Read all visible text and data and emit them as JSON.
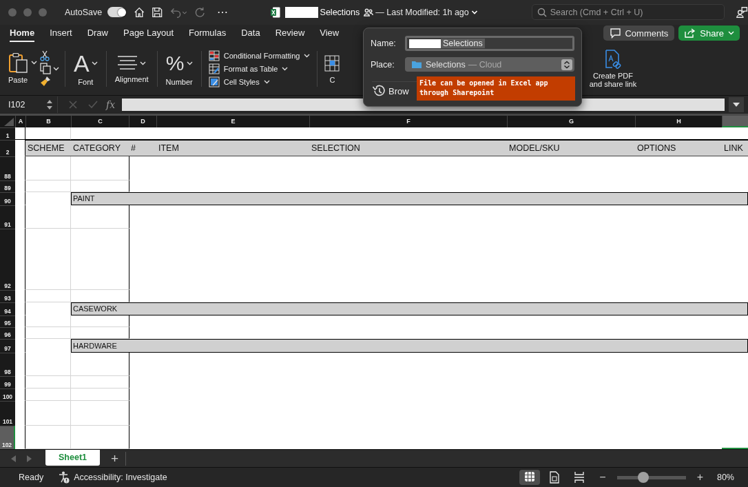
{
  "title_bar": {
    "autosave_label": "AutoSave",
    "autosave_on": true,
    "more": "⋯",
    "file_name": "Selections",
    "modified": "— Last Modified: 1h ago",
    "search_placeholder": "Search (Cmd + Ctrl + U)"
  },
  "ribbon_tabs": [
    {
      "label": "Home",
      "selected": true
    },
    {
      "label": "Insert",
      "selected": false
    },
    {
      "label": "Draw",
      "selected": false
    },
    {
      "label": "Page Layout",
      "selected": false
    },
    {
      "label": "Formulas",
      "selected": false
    },
    {
      "label": "Data",
      "selected": false
    },
    {
      "label": "Review",
      "selected": false
    },
    {
      "label": "View",
      "selected": false
    }
  ],
  "header_buttons": {
    "comments": "Comments",
    "share": "Share"
  },
  "ribbon": {
    "paste": "Paste",
    "font_glyph": "A",
    "font": "Font",
    "alignment": "Alignment",
    "number_glyph": "%",
    "number": "Number",
    "styles": [
      {
        "label": "Conditional Formatting"
      },
      {
        "label": "Format as Table"
      },
      {
        "label": "Cell Styles"
      }
    ],
    "cells_label": "C",
    "pdf": "Create PDF and share link"
  },
  "popover": {
    "name_label": "Name:",
    "name_value": "Selections",
    "place_label": "Place:",
    "place_value": "Selections",
    "place_suffix": "— Cloud",
    "browse": "Brow",
    "note": "File can be opened in Excel app through Sharepoint"
  },
  "formula_bar": {
    "name_box": "I102",
    "fx": "fx"
  },
  "columns": [
    {
      "label": "A",
      "selected": false
    },
    {
      "label": "B",
      "selected": false
    },
    {
      "label": "C",
      "selected": false
    },
    {
      "label": "D",
      "selected": false
    },
    {
      "label": "E",
      "selected": false
    },
    {
      "label": "F",
      "selected": false
    },
    {
      "label": "G",
      "selected": false
    },
    {
      "label": "H",
      "selected": false
    },
    {
      "selected": true
    }
  ],
  "rows": [
    {
      "number": "1",
      "kind": "blank",
      "selected": false
    },
    {
      "number": "2",
      "kind": "header",
      "selected": false,
      "cells": [
        "SCHEME",
        "CATEGORY",
        "#",
        "ITEM",
        "SELECTION",
        "MODEL/SKU",
        "OPTIONS",
        "LINK"
      ]
    },
    {
      "number": "88",
      "kind": "blank",
      "selected": false
    },
    {
      "number": "89",
      "kind": "blank",
      "selected": false
    },
    {
      "number": "90",
      "kind": "band",
      "selected": false,
      "label": "PAINT"
    },
    {
      "number": "91",
      "kind": "blank",
      "selected": false
    },
    {
      "number": "92",
      "kind": "blank",
      "selected": false
    },
    {
      "number": "93",
      "kind": "blank",
      "selected": false
    },
    {
      "number": "94",
      "kind": "band",
      "selected": false,
      "label": "CASEWORK"
    },
    {
      "number": "95",
      "kind": "blank",
      "selected": false
    },
    {
      "number": "96",
      "kind": "blank",
      "selected": false
    },
    {
      "number": "97",
      "kind": "band",
      "selected": false,
      "label": "HARDWARE"
    },
    {
      "number": "98",
      "kind": "blank",
      "selected": false
    },
    {
      "number": "99",
      "kind": "blank",
      "selected": false
    },
    {
      "number": "100",
      "kind": "blank",
      "selected": false
    },
    {
      "number": "101",
      "kind": "blank",
      "selected": false
    },
    {
      "number": "102",
      "kind": "blank",
      "selected": true
    }
  ],
  "sheet_tabs": [
    {
      "label": "Sheet1",
      "selected": true
    }
  ],
  "add_sheet": "+",
  "status_bar": {
    "ready": "Ready",
    "accessibility": "Accessibility: Investigate",
    "views": [
      {
        "kind": "normal",
        "selected": true
      },
      {
        "kind": "page",
        "selected": false
      },
      {
        "kind": "break",
        "selected": false
      }
    ],
    "zoom_minus": "−",
    "zoom_plus": "+",
    "zoom": {
      "level": 0.4
    },
    "zoom_text": "80%"
  }
}
